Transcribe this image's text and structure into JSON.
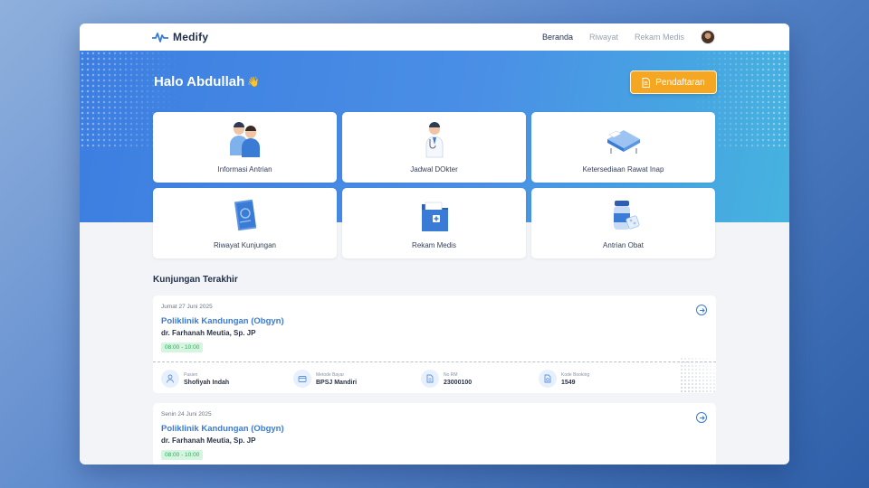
{
  "brand": {
    "name": "Medify"
  },
  "nav": {
    "items": [
      {
        "label": "Beranda",
        "active": true
      },
      {
        "label": "Riwayat",
        "active": false
      },
      {
        "label": "Rekam Medis",
        "active": false
      }
    ]
  },
  "hero": {
    "greeting": "Halo Abdullah",
    "greeting_emoji": "👋",
    "cta_label": "Pendaftaran"
  },
  "tiles": [
    {
      "label": "Informasi Antrian",
      "icon": "people-icon"
    },
    {
      "label": "Jadwal DOkter",
      "icon": "doctor-icon"
    },
    {
      "label": "Ketersediaan Rawat Inap",
      "icon": "hospital-bed-icon"
    },
    {
      "label": "Riwayat Kunjungan",
      "icon": "document-scroll-icon"
    },
    {
      "label": "Rekam Medis",
      "icon": "medical-folder-icon"
    },
    {
      "label": "Antrian Obat",
      "icon": "medicine-icon"
    }
  ],
  "recent": {
    "title": "Kunjungan Terakhir",
    "visits": [
      {
        "date": "Jumat 27 Juni 2025",
        "clinic": "Poliklinik Kandungan (Obgyn)",
        "doctor": "dr. Farhanah Meutia, Sp. JP",
        "time": "08:00 - 10:00",
        "details": {
          "patient_label": "Pasien",
          "patient": "Shofiyah Indah",
          "payment_label": "Metode Bayar",
          "payment": "BPSJ Mandiri",
          "rm_label": "No RM",
          "rm": "23000100",
          "booking_label": "Kode Booking",
          "booking": "1549"
        }
      },
      {
        "date": "Senin 24 Juni 2025",
        "clinic": "Poliklinik Kandungan (Obgyn)",
        "doctor": "dr. Farhanah Meutia, Sp. JP",
        "time": "08:00 - 10:00"
      }
    ]
  },
  "colors": {
    "primary": "#3a7bd5",
    "accent": "#f5a623",
    "success": "#2bab5a"
  }
}
